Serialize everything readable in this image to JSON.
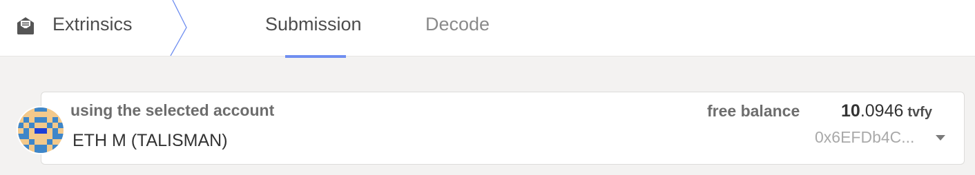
{
  "header": {
    "section_label": "Extrinsics",
    "section_icon": "envelope-icon",
    "tabs": [
      {
        "label": "Submission",
        "active": true
      },
      {
        "label": "Decode",
        "active": false
      }
    ],
    "accent_color": "#6f8ef0"
  },
  "account": {
    "label": "using the selected account",
    "name": "ETH M (TALISMAN)",
    "avatar": "identicon",
    "balance_label": "free balance",
    "balance_integer": "10",
    "balance_fraction": ".0946",
    "balance_unit": "tvfy",
    "address": "0x6EFDb4C...",
    "dropdown_icon": "caret-down-icon"
  }
}
